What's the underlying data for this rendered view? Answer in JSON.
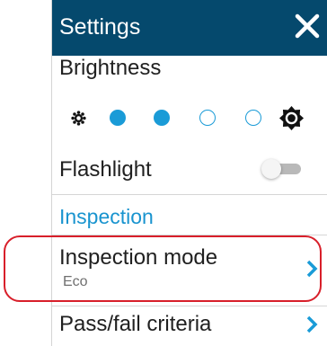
{
  "header": {
    "title": "Settings",
    "close_icon": "close-icon"
  },
  "brightness": {
    "label": "Brightness",
    "levels": [
      true,
      true,
      false,
      false
    ],
    "accent": "#1a9bd7"
  },
  "flashlight": {
    "label": "Flashlight",
    "enabled": false
  },
  "inspection": {
    "section_title": "Inspection",
    "mode": {
      "label": "Inspection mode",
      "value": "Eco"
    },
    "criteria": {
      "label": "Pass/fail criteria"
    }
  },
  "colors": {
    "header": "#05496d",
    "accent": "#1a9bd7",
    "highlight": "#d81f2a"
  }
}
